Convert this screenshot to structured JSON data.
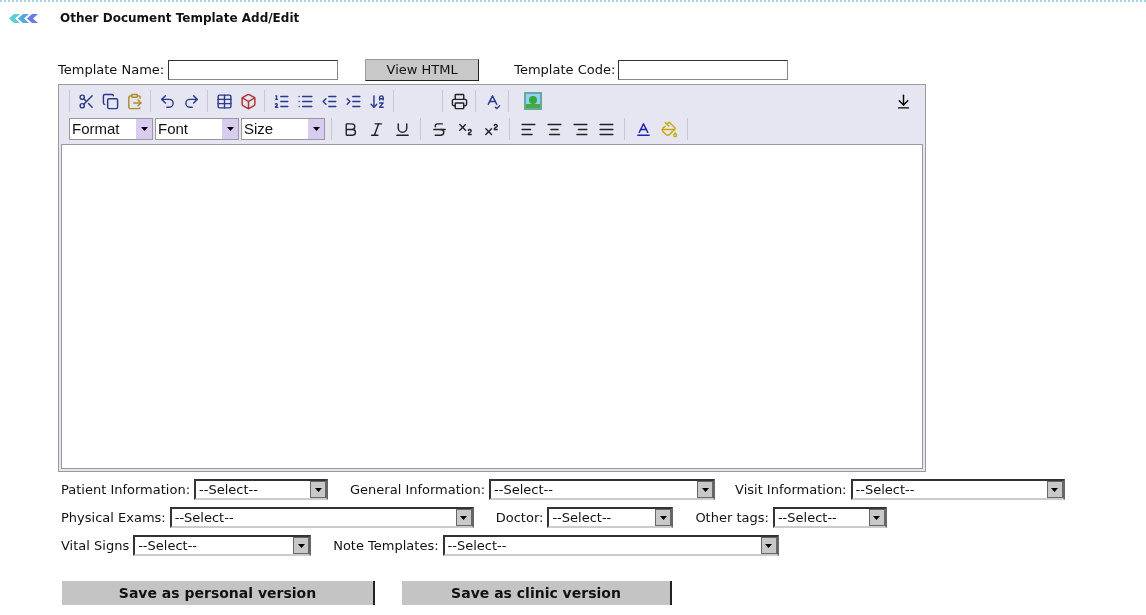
{
  "header": {
    "title": "Other Document Template Add/Edit"
  },
  "template_fields": [
    {
      "label": "Template Name:"
    },
    {
      "label": "Template Code:"
    }
  ],
  "view_html_button": "View HTML",
  "editor": {
    "toolbar_selects": [
      {
        "value": "Format"
      },
      {
        "value": "Font"
      },
      {
        "value": "Size"
      }
    ]
  },
  "tag_rows": [
    [
      {
        "label": "Patient Information:",
        "value": "--Select--"
      },
      {
        "label": "General Information:",
        "value": "--Select--"
      },
      {
        "label": "Visit Information:",
        "value": "--Select--"
      }
    ],
    [
      {
        "label": "Physical Exams:",
        "value": "--Select--"
      },
      {
        "label": "Doctor:",
        "value": "--Select--"
      },
      {
        "label": "Other tags:",
        "value": "--Select--"
      }
    ],
    [
      {
        "label": "Vital Signs",
        "value": "--Select--"
      },
      {
        "label": "Note Templates:",
        "value": "--Select--"
      }
    ]
  ],
  "buttons": [
    "Save as personal version",
    "Save as clinic version"
  ]
}
